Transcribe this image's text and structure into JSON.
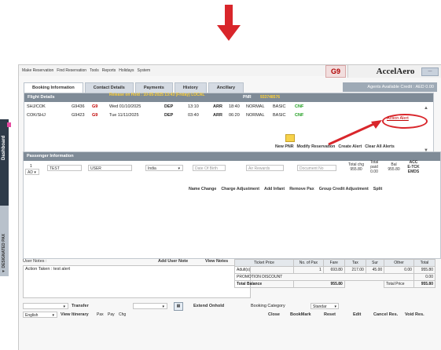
{
  "app": {
    "brand": "AccelAero",
    "airline_code": "G9",
    "menu": [
      "Make Reservation",
      "Find Reservation",
      "Tools",
      "Reports",
      "Holidays",
      "System"
    ],
    "window_button": "—",
    "tabs": [
      "Booking Information",
      "Contact Details",
      "Payments",
      "History",
      "Ancillary"
    ],
    "agent_credit": "Agents Available Credit : AED 0.00",
    "left_tabs": {
      "dashboard": "Dashboard",
      "nav": "▼ DESIGNATED PAX"
    }
  },
  "flights": {
    "header": "Flight Details",
    "release_text": "Release on Hold : 10-05-2025 13:43 (Friday) LOCAL",
    "pnr_label": "PNR",
    "pnr_value": "933748576",
    "rows": [
      {
        "route": "SHJ/COK",
        "flight": "G9436",
        "carrier": "G9",
        "date": "Wed 01/10/2025",
        "dep_label": "DEP",
        "dep": "13:10",
        "arr_label": "ARR",
        "arr": "18:40",
        "type": "NORMAL",
        "fare": "BASIC",
        "status": "CNF"
      },
      {
        "route": "COK/SHJ",
        "flight": "G9423",
        "carrier": "G9",
        "date": "Tue 11/11/2025",
        "dep_label": "DEP",
        "dep": "03:40",
        "arr_label": "ARR",
        "arr": "06:20",
        "type": "NORMAL",
        "fare": "BASIC",
        "status": "CNF"
      }
    ],
    "action_alert": "Action Alert",
    "buttons": [
      "New PNR",
      "Modify Reservation",
      "Create Alert",
      "Clear All Alerts"
    ]
  },
  "passenger": {
    "header": "Passenger Information",
    "type": "AD",
    "index": "1",
    "first_name": "TEST",
    "last_name": "USER",
    "nationality": "India",
    "dob_placeholder": "Date Of Birth",
    "air_rewards_placeholder": "Air Rewards",
    "document_placeholder": "Document No",
    "total_chg_label": "Total chg",
    "total_chg": "955.80",
    "total_paid_label": "Total paid",
    "total_paid": "0.00",
    "balance_label": "Bal",
    "balance": "955.80",
    "acc_label": "ACC",
    "etkt_label": "E-TCK",
    "emds_label": "EMDS",
    "actions": [
      "Name Change",
      "Charge Adjustment",
      "Add Infant",
      "Remove Pax",
      "Group Credit Adjustment",
      "Split"
    ]
  },
  "notes": {
    "label": "User Notes :",
    "add_label": "Add User Note",
    "view_label": "View Notes",
    "text": "Action Taken : test alert"
  },
  "fare": {
    "headers": [
      "Ticket Price",
      "No. of Pax",
      "Fare",
      "Tax",
      "Sur",
      "Other",
      "Total"
    ],
    "rows": [
      {
        "label": "Adult(s)",
        "pax": "1",
        "fare": "693.80",
        "tax": "217.00",
        "sur": "45.00",
        "other": "0.00",
        "total": "955.80"
      },
      {
        "label": "PROMOTION DISCOUNT",
        "pax": "",
        "fare": "",
        "tax": "",
        "sur": "",
        "other": "",
        "total": "0.00"
      }
    ],
    "total_balance_label": "Total Balance",
    "total_balance": "955.80",
    "total_price_label": "Total Price",
    "total_price": "955.80"
  },
  "bottom": {
    "transfer": "Transfer",
    "extend": "Extend Onhold",
    "booking_category_label": "Booking Category",
    "booking_category": "Standar",
    "language": "English",
    "view_itinerary": "View Itinerary",
    "itinerary_opts": [
      "Pax",
      "Pay",
      "Chg"
    ],
    "buttons": [
      "Close",
      "BookMark",
      "Reset",
      "Edit",
      "Cancel Res.",
      "Void Res."
    ]
  },
  "colors": {
    "arrow": "#d9262b",
    "header": "#7f8b97",
    "accent_red": "#c00000",
    "confirm": "#1a9b1a"
  }
}
